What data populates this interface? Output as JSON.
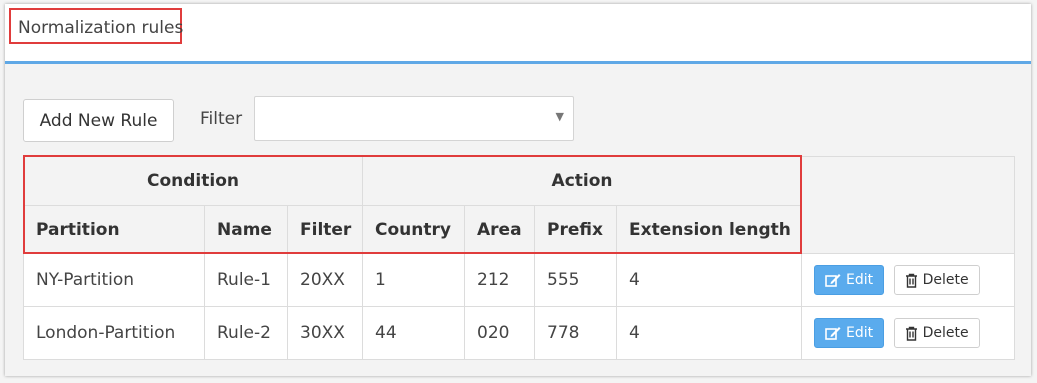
{
  "panel": {
    "title": "Normalization rules",
    "accent_color": "#5fa8e6",
    "highlight_color": "#e03c3c"
  },
  "toolbar": {
    "add_label": "Add New Rule",
    "filter_label": "Filter",
    "filter_value": ""
  },
  "table": {
    "groups": [
      "Condition",
      "Action"
    ],
    "columns": [
      "Partition",
      "Name",
      "Filter",
      "Country",
      "Area",
      "Prefix",
      "Extension length"
    ],
    "rows": [
      {
        "cells": [
          "NY-Partition",
          "Rule-1",
          "20XX",
          "1",
          "212",
          "555",
          "4"
        ]
      },
      {
        "cells": [
          "London-Partition",
          "Rule-2",
          "30XX",
          "44",
          "020",
          "778",
          "4"
        ]
      }
    ],
    "edit_label": "Edit",
    "delete_label": "Delete",
    "edit_icon": "edit-icon",
    "delete_icon": "trash-icon"
  }
}
